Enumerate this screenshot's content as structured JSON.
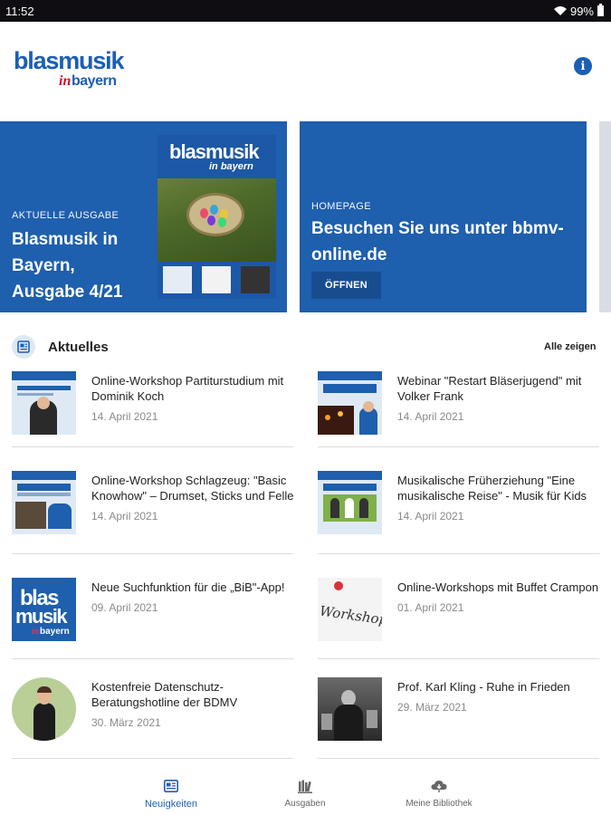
{
  "statusbar": {
    "time": "11:52",
    "battery": "99%"
  },
  "header": {
    "logo_primary": "blasmusik",
    "logo_secondary": "in bayern",
    "info_icon": "i"
  },
  "carousel": [
    {
      "eyebrow": "AKTUELLE AUSGABE",
      "title": "Blasmusik in Bayern, Ausgabe 4/21",
      "cover_text": "blasmusik",
      "cover_text_sub": "in bayern"
    },
    {
      "eyebrow": "HOMEPAGE",
      "title": "Besuchen Sie uns unter bbmv-online.de",
      "button": "ÖFFNEN"
    }
  ],
  "section": {
    "title": "Aktuelles",
    "show_all": "Alle zeigen",
    "icon": "news-icon"
  },
  "news": [
    {
      "title": "Online-Workshop Partiturstudium mit Dominik Koch",
      "date": "14. April 2021"
    },
    {
      "title": "Webinar \"Restart Bläserjugend\" mit Volker Frank",
      "date": "14. April 2021"
    },
    {
      "title": "Online-Workshop Schlagzeug: \"Basic Knowhow\" – Drumset, Sticks und Felle",
      "date": "14. April 2021"
    },
    {
      "title": "Musikalische Früherziehung \"Eine musikalische Reise\" - Musik für Kids",
      "date": "14. April 2021"
    },
    {
      "title": "Neue Suchfunktion für die „BiB\"-App!",
      "date": "09. April 2021"
    },
    {
      "title": "Online-Workshops mit Buffet Crampon",
      "date": "01. April 2021"
    },
    {
      "title": "Kostenfreie Datenschutz-Beratungshotline der BDMV",
      "date": "30. März 2021"
    },
    {
      "title": "Prof. Karl Kling - Ruhe in Frieden",
      "date": "29. März 2021"
    }
  ],
  "bottom_nav": [
    {
      "label": "Neuigkeiten",
      "icon": "news-icon",
      "active": true
    },
    {
      "label": "Ausgaben",
      "icon": "library-shelf-icon",
      "active": false
    },
    {
      "label": "Meine Bibliothek",
      "icon": "cloud-download-icon",
      "active": false
    }
  ],
  "colors": {
    "brand_blue": "#1e5fae",
    "status_bar": "#0f0d12",
    "date_gray": "#8a8a8a"
  }
}
